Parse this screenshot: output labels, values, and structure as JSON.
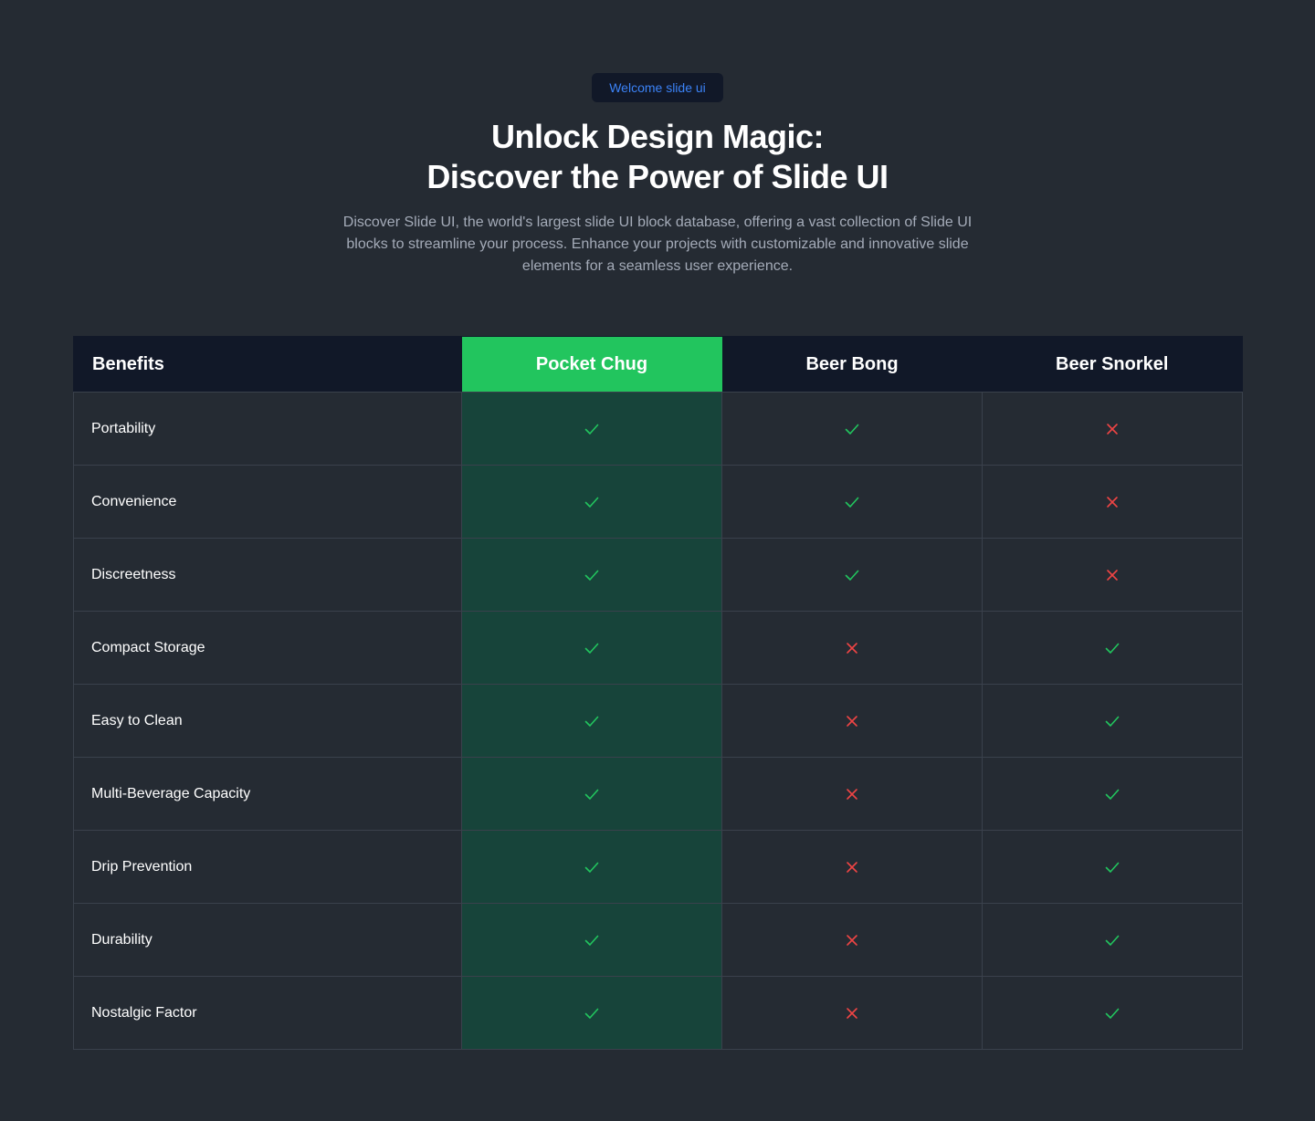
{
  "hero": {
    "badge": "Welcome slide ui",
    "title_line1": "Unlock Design Magic:",
    "title_line2": "Discover the Power of Slide UI",
    "description": "Discover Slide UI, the world's largest slide UI block database, offering a vast collection of Slide UI blocks to streamline your process. Enhance your projects with customizable and innovative slide elements for a seamless user experience."
  },
  "table": {
    "header": {
      "benefits": "Benefits",
      "products": [
        "Pocket Chug",
        "Beer Bong",
        "Beer Snorkel"
      ]
    },
    "rows": [
      {
        "benefit": "Portability",
        "values": [
          true,
          true,
          false
        ]
      },
      {
        "benefit": "Convenience",
        "values": [
          true,
          true,
          false
        ]
      },
      {
        "benefit": "Discreetness",
        "values": [
          true,
          true,
          false
        ]
      },
      {
        "benefit": "Compact Storage",
        "values": [
          true,
          false,
          true
        ]
      },
      {
        "benefit": "Easy to Clean",
        "values": [
          true,
          false,
          true
        ]
      },
      {
        "benefit": "Multi-Beverage Capacity",
        "values": [
          true,
          false,
          true
        ]
      },
      {
        "benefit": "Drip Prevention",
        "values": [
          true,
          false,
          true
        ]
      },
      {
        "benefit": "Durability",
        "values": [
          true,
          false,
          true
        ]
      },
      {
        "benefit": "Nostalgic Factor",
        "values": [
          true,
          false,
          true
        ]
      }
    ],
    "icons": {
      "yes": "check-icon",
      "no": "cross-icon"
    }
  },
  "colors": {
    "background": "#252b33",
    "accent_green": "#22c55e",
    "highlight_column": "#17443a",
    "header_bg": "#111828",
    "badge_text": "#3b82f6",
    "cross_red": "#ef4444",
    "border": "#3a414c"
  }
}
